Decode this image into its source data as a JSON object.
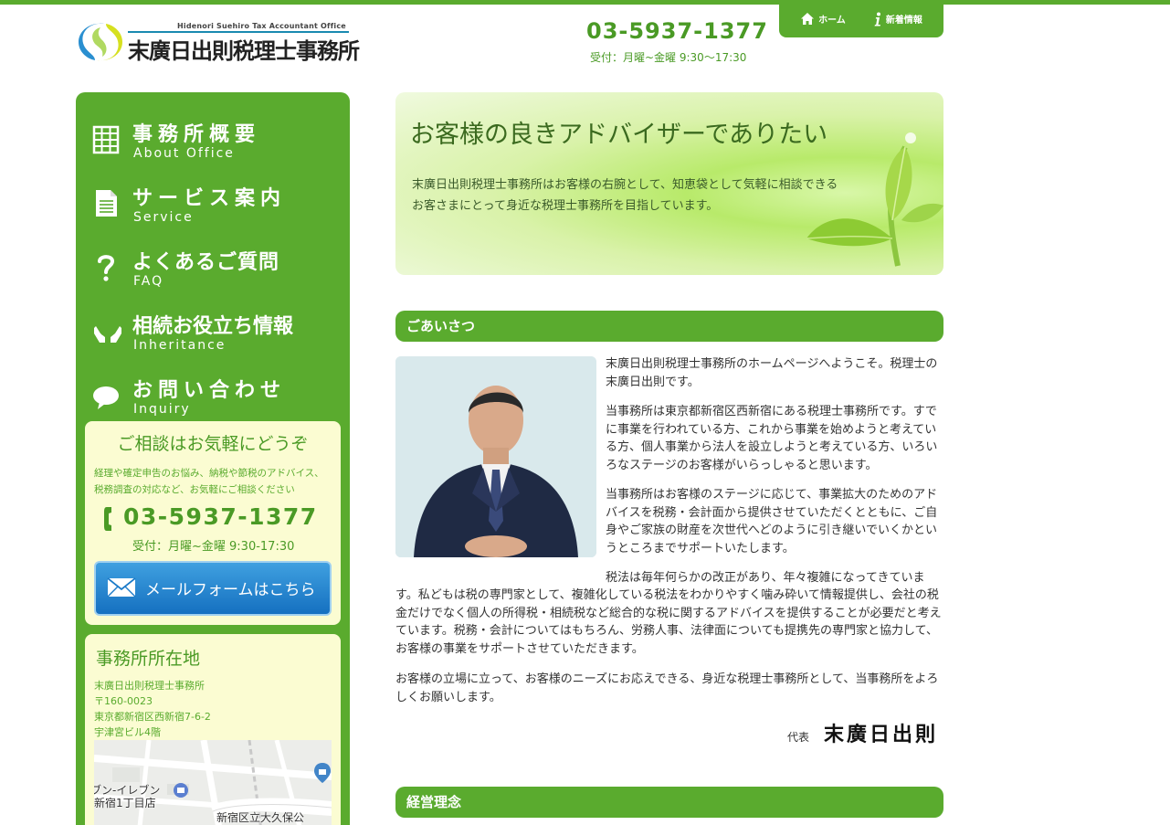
{
  "header": {
    "logo_en": "Hidenori Suehiro Tax Accountant Office",
    "logo_jp": "末廣日出則税理士事務所",
    "phone": "03-5937-1377",
    "hours": "受付：月曜~金曜 9:30〜17:30",
    "nav": [
      {
        "label": "ホーム",
        "icon": "home-icon"
      },
      {
        "label": "新着情報",
        "icon": "info-icon"
      }
    ]
  },
  "sidebar": {
    "items": [
      {
        "jp": "事務所概要",
        "en": "About Office",
        "icon": "building-icon"
      },
      {
        "jp": "サービス案内",
        "en": "Service",
        "icon": "document-icon"
      },
      {
        "jp": "よくあるご質問",
        "en": "FAQ",
        "icon": "question-icon"
      },
      {
        "jp": "相続お役立ち情報",
        "en": "Inheritance",
        "icon": "hands-icon"
      },
      {
        "jp": "お問い合わせ",
        "en": "Inquiry",
        "icon": "speech-bubble-icon"
      }
    ],
    "consult": {
      "title": "ご相談はお気軽にどうぞ",
      "text": "経理や確定申告のお悩み、納税や節税のアドバイス、税務調査の対応など、お気軽にご相談ください",
      "phone": "03-5937-1377",
      "hours": "受付：月曜~金曜 9:30-17:30",
      "mail_button": "メールフォームはこちら"
    },
    "office": {
      "title": "事務所所在地",
      "name": "末廣日出則税理士事務所",
      "postal": "〒160-0023",
      "address": "東京都新宿区西新宿7-6-2",
      "building": "宇津宮ビル4階",
      "map_labels": [
        "ブン-イレブン",
        "新宿1丁目店",
        "新宿区立大久保公"
      ]
    }
  },
  "hero": {
    "title": "お客様の良きアドバイザーでありたい",
    "line1": "末廣日出則税理士事務所はお客様の右腕として、知恵袋として気軽に相談できる",
    "line2": "お客さまにとって身近な税理士事務所を目指しています。"
  },
  "greeting": {
    "heading": "ごあいさつ",
    "p1": "末廣日出則税理士事務所のホームページへようこそ。税理士の末廣日出則です。",
    "p2": "当事務所は東京都新宿区西新宿にある税理士事務所です。すでに事業を行われている方、これから事業を始めようと考えている方、個人事業から法人を設立しようと考えている方、いろいろなステージのお客様がいらっしゃると思います。",
    "p3": "当事務所はお客様のステージに応じて、事業拡大のためのアドバイスを税務・会計面から提供させていただくとともに、ご自身やご家族の財産を次世代へどのように引き継いでいくかというところまでサポートいたします。",
    "p4_lead": "税法は毎年何らかの改正があり、年々複雑になってきていま",
    "p4_rest": "す。私どもは税の専門家として、複雑化している税法をわかりやすく噛み砕いて情報提供し、会社の税金だけでなく個人の所得税・相続税など総合的な税に関するアドバイスを提供することが必要だと考えています。税務・会計についてはもちろん、労務人事、法律面についても提携先の専門家と協力して、お客様の事業をサポートさせていただきます。",
    "p5": "お客様の立場に立って、お客様のニーズにお応えできる、身近な税理士事務所として、当事務所をよろしくお願いします。",
    "sig_title": "代表",
    "sig_name": "末廣日出則"
  },
  "philosophy": {
    "heading": "経営理念"
  }
}
